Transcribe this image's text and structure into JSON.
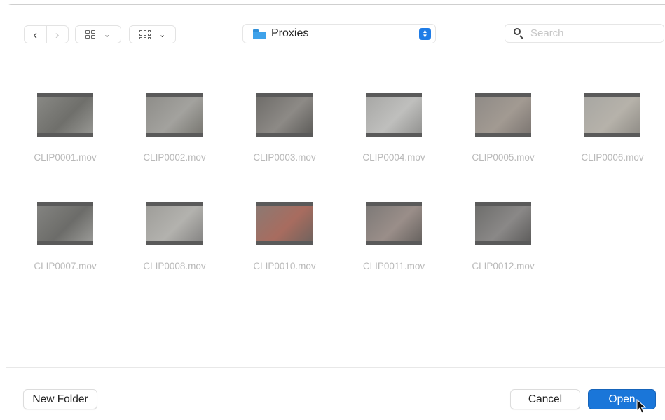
{
  "toolbar": {
    "back_glyph": "‹",
    "forward_glyph": "›",
    "view_icon": "icon-grid-icon",
    "group_icon": "group-grid-icon",
    "location": "Proxies",
    "search_placeholder": "Search"
  },
  "files": [
    {
      "name": "CLIP0001.mov",
      "colors": [
        "#8a8a86",
        "#6f6f6b",
        "#9a9a96"
      ]
    },
    {
      "name": "CLIP0002.mov",
      "colors": [
        "#8d8c88",
        "#a3a29e",
        "#76756f"
      ]
    },
    {
      "name": "CLIP0003.mov",
      "colors": [
        "#6d6b68",
        "#8d8a86",
        "#5b5a57"
      ]
    },
    {
      "name": "CLIP0004.mov",
      "colors": [
        "#a6a6a4",
        "#bfbfbd",
        "#8f8f8d"
      ]
    },
    {
      "name": "CLIP0005.mov",
      "colors": [
        "#8e8a86",
        "#a29a92",
        "#7a7470"
      ]
    },
    {
      "name": "CLIP0006.mov",
      "colors": [
        "#a7a6a2",
        "#b6b2aa",
        "#8d8a84"
      ]
    },
    {
      "name": "CLIP0007.mov",
      "colors": [
        "#858582",
        "#6c6c69",
        "#9e9e9b"
      ]
    },
    {
      "name": "CLIP0008.mov",
      "colors": [
        "#9d9c98",
        "#b3b2ae",
        "#828180"
      ]
    },
    {
      "name": "CLIP0010.mov",
      "colors": [
        "#8a7a74",
        "#a86c5f",
        "#6c625d"
      ]
    },
    {
      "name": "CLIP0011.mov",
      "colors": [
        "#7b7876",
        "#9a8e89",
        "#635f5c"
      ]
    },
    {
      "name": "CLIP0012.mov",
      "colors": [
        "#6c6c6a",
        "#8a8887",
        "#5a5958"
      ]
    }
  ],
  "footer": {
    "new_folder_label": "New Folder",
    "cancel_label": "Cancel",
    "open_label": "Open"
  },
  "colors": {
    "accent": "#1a76d9",
    "filename_text": "#b9b9b9"
  }
}
